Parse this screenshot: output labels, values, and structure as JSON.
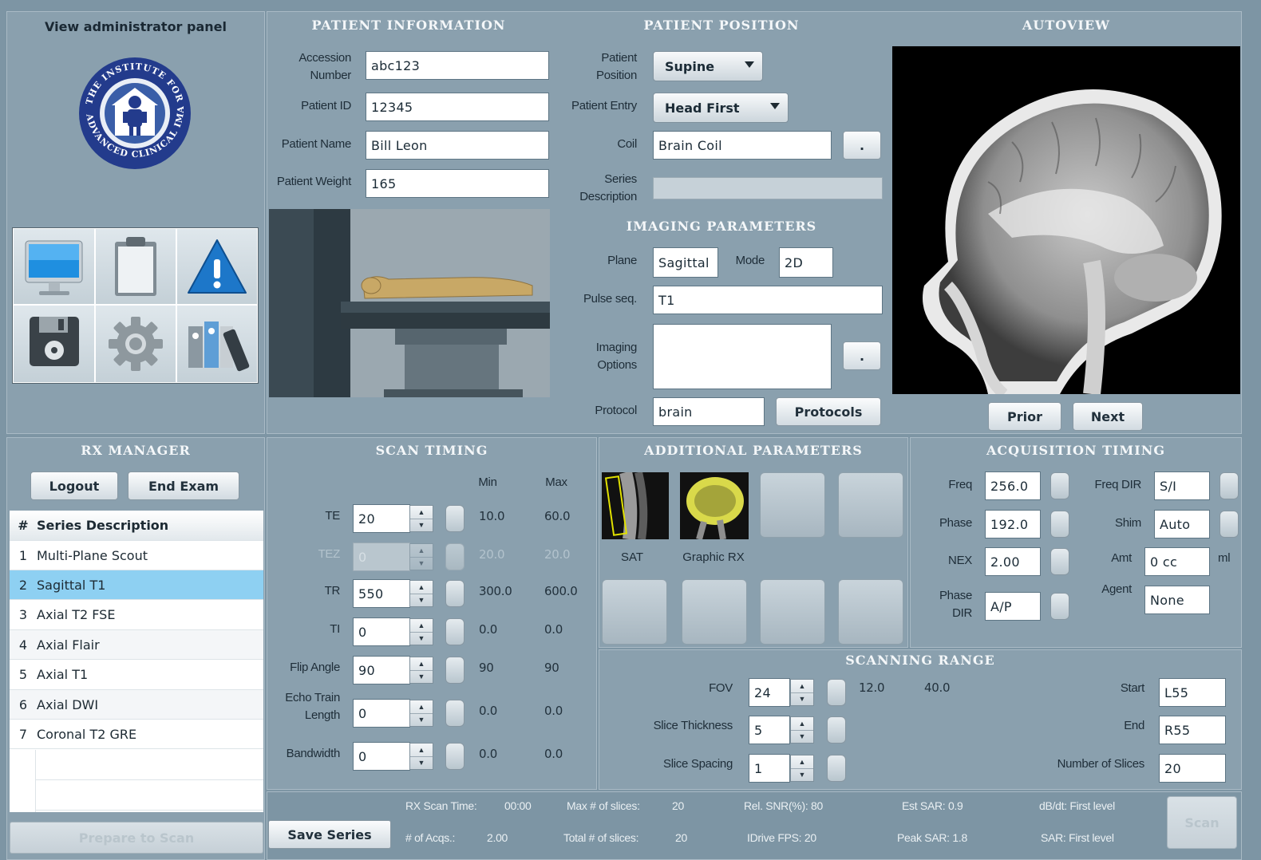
{
  "admin_link": "View administrator panel",
  "logo_text": "THE INSTITUTE FOR ADVANCED CLINICAL IMAGING",
  "tiles": [
    "monitor-icon",
    "clipboard-icon",
    "warning-icon",
    "floppy-disk-icon",
    "gear-icon",
    "files-icon"
  ],
  "patient_info": {
    "title": "PATIENT INFORMATION",
    "accession_label_1": "Accession",
    "accession_label_2": "Number",
    "accession": "abc123",
    "patient_id_label": "Patient ID",
    "patient_id": "12345",
    "patient_name_label": "Patient Name",
    "patient_name": "Bill Leon",
    "patient_weight_label": "Patient Weight",
    "patient_weight": "165"
  },
  "patient_position": {
    "title": "PATIENT POSITION",
    "position_label_1": "Patient",
    "position_label_2": "Position",
    "position": "Supine",
    "entry_label": "Patient Entry",
    "entry": "Head First",
    "coil_label": "Coil",
    "coil": "Brain Coil",
    "coil_btn": ".",
    "series_desc_label_1": "Series",
    "series_desc_label_2": "Description",
    "series_desc": ""
  },
  "imaging": {
    "title": "IMAGING PARAMETERS",
    "plane_label": "Plane",
    "plane": "Sagittal",
    "mode_label": "Mode",
    "mode": "2D",
    "pulse_label": "Pulse seq.",
    "pulse": "T1",
    "options_label_1": "Imaging",
    "options_label_2": "Options",
    "options_btn": ".",
    "protocol_label": "Protocol",
    "protocol": "brain",
    "protocols_btn": "Protocols"
  },
  "autoview": {
    "title": "AUTOVIEW",
    "prior": "Prior",
    "next": "Next"
  },
  "rx_manager": {
    "title": "RX MANAGER",
    "logout": "Logout",
    "end_exam": "End Exam",
    "col_num": "#",
    "col_desc": "Series Description",
    "rows": [
      {
        "n": "1",
        "desc": "Multi-Plane Scout"
      },
      {
        "n": "2",
        "desc": "Sagittal T1"
      },
      {
        "n": "3",
        "desc": "Axial T2 FSE"
      },
      {
        "n": "4",
        "desc": "Axial Flair"
      },
      {
        "n": "5",
        "desc": "Axial T1"
      },
      {
        "n": "6",
        "desc": "Axial DWI"
      },
      {
        "n": "7",
        "desc": "Coronal T2 GRE"
      }
    ],
    "prepare": "Prepare to Scan"
  },
  "scan_timing": {
    "title": "SCAN TIMING",
    "min_label": "Min",
    "max_label": "Max",
    "te_label": "TE",
    "te": "20",
    "te_min": "10.0",
    "te_max": "60.0",
    "tez_label": "TEZ",
    "tez": "0",
    "tez_min": "20.0",
    "tez_max": "20.0",
    "tr_label": "TR",
    "tr": "550",
    "tr_min": "300.0",
    "tr_max": "600.0",
    "ti_label": "TI",
    "ti": "0",
    "ti_min": "0.0",
    "ti_max": "0.0",
    "flip_label": "Flip Angle",
    "flip": "90",
    "flip_min": "90",
    "flip_max": "90",
    "etl_label_1": "Echo Train",
    "etl_label_2": "Length",
    "etl": "0",
    "etl_min": "0.0",
    "etl_max": "0.0",
    "bw_label": "Bandwidth",
    "bw": "0",
    "bw_min": "0.0",
    "bw_max": "0.0"
  },
  "additional": {
    "title": "ADDITIONAL PARAMETERS",
    "sat_label": "SAT",
    "graphic_label": "Graphic RX"
  },
  "acq_timing": {
    "title": "ACQUISITION TIMING",
    "freq_label": "Freq",
    "freq": "256.0",
    "phase_label": "Phase",
    "phase": "192.0",
    "nex_label": "NEX",
    "nex": "2.00",
    "phase_dir_label_1": "Phase",
    "phase_dir_label_2": "DIR",
    "phase_dir": "A/P",
    "freq_dir_label": "Freq DIR",
    "freq_dir": "S/I",
    "shim_label": "Shim",
    "shim": "Auto",
    "amt_label": "Amt",
    "amt": "0 cc",
    "amt_unit": "ml",
    "agent_label": "Agent",
    "agent": "None"
  },
  "scanning_range": {
    "title": "SCANNING RANGE",
    "fov_label": "FOV",
    "fov": "24",
    "fov_min": "12.0",
    "fov_max": "40.0",
    "thick_label": "Slice Thickness",
    "thick": "5",
    "spacing_label": "Slice Spacing",
    "spacing": "1",
    "start_label": "Start",
    "start": "L55",
    "end_label": "End",
    "end": "R55",
    "num_label": "Number of Slices",
    "num": "20"
  },
  "footer": {
    "save_series": "Save Series",
    "rx_scan_time": "RX Scan Time:",
    "rx_scan_time_val": "00:00",
    "acqs": "# of Acqs.:",
    "acqs_val": "2.00",
    "max_slices": "Max # of slices:",
    "max_slices_val": "20",
    "total_slices": "Total # of slices:",
    "total_slices_val": "20",
    "rel_snr": "Rel. SNR(%): 80",
    "idrive": "IDrive FPS: 20",
    "est_sar": "Est SAR: 0.9",
    "peak_sar": "Peak SAR: 1.8",
    "dbdt": "dB/dt: First level",
    "sar": "SAR: First level",
    "scan": "Scan"
  },
  "colors": {
    "background": "#7d95a4",
    "panel": "#8aa0ae",
    "selected_row": "#8ed0f2",
    "title_text": "#f4f7f9"
  }
}
